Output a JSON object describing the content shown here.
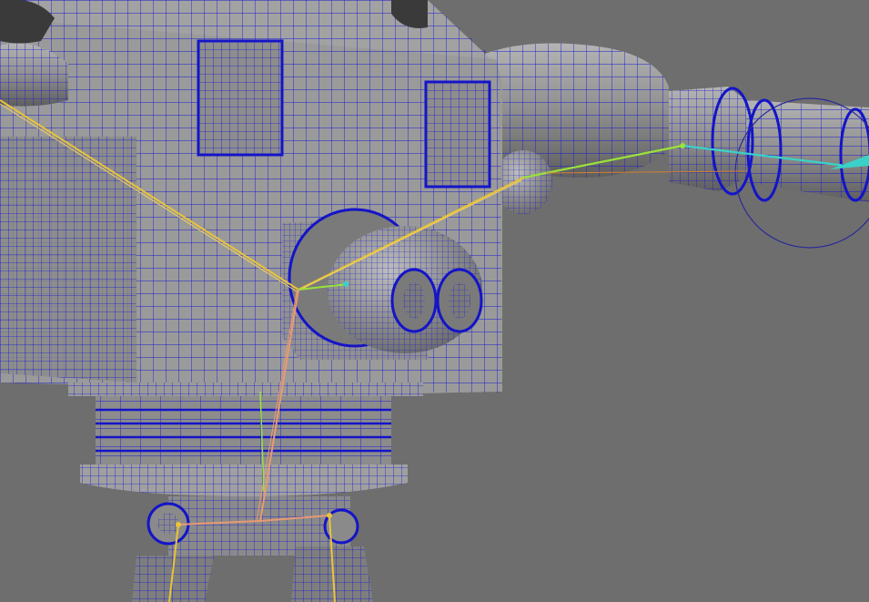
{
  "app": {
    "view": "3D viewport",
    "shading": "wireframe-on-shaded"
  },
  "colors": {
    "background": "#6e6e6e",
    "surface": "#9a9a9a",
    "surface_dark": "#7e7e7e",
    "wire": "#1414c8",
    "joint_main": "#e8c33a",
    "joint_leg": "#e89a72",
    "joint_arm": "#9ae23a",
    "joint_wrist": "#3ad2c8",
    "ik_handle": "#2a2a9a"
  },
  "icons": {
    "rig": "skeleton-joint-icon"
  }
}
